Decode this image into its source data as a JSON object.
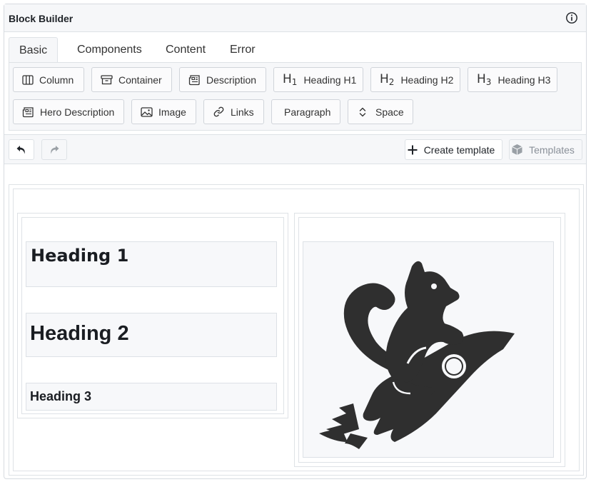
{
  "panel": {
    "title": "Block Builder",
    "info_icon": "info-icon"
  },
  "tabs": [
    {
      "label": "Basic",
      "active": true
    },
    {
      "label": "Components",
      "active": false
    },
    {
      "label": "Content",
      "active": false
    },
    {
      "label": "Error",
      "active": false
    }
  ],
  "blocks": {
    "row1": [
      {
        "label": "Column",
        "icon": "columns-icon"
      },
      {
        "label": "Container",
        "icon": "archive-icon"
      },
      {
        "label": "Description",
        "icon": "newspaper-icon"
      },
      {
        "label": "Heading H1",
        "icon": "h1-icon"
      },
      {
        "label": "Heading H2",
        "icon": "h2-icon"
      },
      {
        "label": "Heading H3",
        "icon": "h3-icon"
      }
    ],
    "row2": [
      {
        "label": "Hero Description",
        "icon": "newspaper-icon"
      },
      {
        "label": "Image",
        "icon": "image-icon"
      },
      {
        "label": "Links",
        "icon": "link-icon"
      },
      {
        "label": "Paragraph",
        "icon": ""
      },
      {
        "label": "Space",
        "icon": "vertical-arrows-icon"
      }
    ]
  },
  "toolbar": {
    "undo_icon": "undo-icon",
    "redo_icon": "redo-icon",
    "create_template_label": "Create template",
    "templates_label": "Templates"
  },
  "canvas": {
    "heading1": "Heading 1",
    "heading2": "Heading 2",
    "heading3": "Heading 3",
    "image_icon": "squirrel-rocket-illustration"
  },
  "colors": {
    "accent_bg": "#f6f7f9",
    "border": "#dee2e6",
    "illustration": "#2f2f2f"
  }
}
